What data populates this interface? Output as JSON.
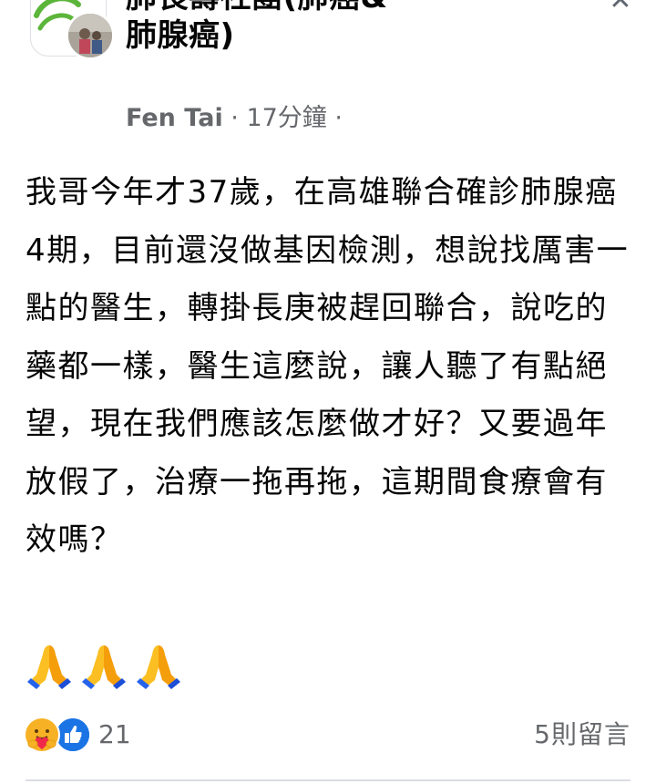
{
  "group": {
    "name": "肺長壽社團(肺癌&\n肺腺癌)"
  },
  "post": {
    "author": "Fen Tai",
    "separator": " · ",
    "time": "17分鐘",
    "trailing_dot": " ·",
    "text": "我哥今年才37歲，在高雄聯合確診肺腺癌4期，目前還沒做基因檢測，想說找厲害一點的醫生，轉掛長庚被趕回聯合，說吃的藥都一樣，醫生這麼說，讓人聽了有點絕望，現在我們應該怎麼做才好？又要過年放假了，治療一拖再拖，這期間食療會有效嗎？",
    "emojis": [
      "folded-hands",
      "folded-hands",
      "folded-hands"
    ]
  },
  "footer": {
    "reaction_count": "21",
    "comment_count": "5則留言"
  },
  "icons": {
    "close": "close-icon",
    "care": "care-reaction-icon",
    "like": "like-reaction-icon"
  },
  "colors": {
    "secondary_text": "#65676b",
    "like_blue": "#1b74e4",
    "care_yellow": "#f7b125",
    "care_heart": "#f0284a",
    "logo_green": "#5bb53a"
  }
}
